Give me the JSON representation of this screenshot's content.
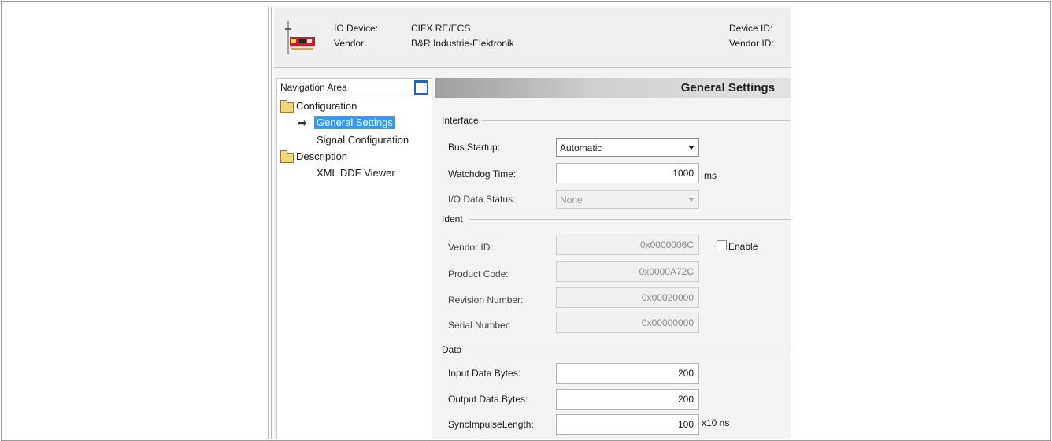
{
  "header": {
    "io_device_label": "IO Device:",
    "io_device_value": "CIFX RE/ECS",
    "vendor_label": "Vendor:",
    "vendor_value": "B&R Industrie-Elektronik",
    "device_id_label": "Device ID:",
    "vendor_id_label": "Vendor ID:"
  },
  "nav": {
    "title": "Navigation Area",
    "tree": [
      {
        "label": "Configuration",
        "icon": "folder-icon"
      },
      {
        "label": "General Settings",
        "selected": true,
        "icon": "arrow-right-icon"
      },
      {
        "label": "Signal Configuration"
      },
      {
        "label": "Description",
        "icon": "folder-icon"
      },
      {
        "label": "XML DDF Viewer"
      }
    ]
  },
  "page": {
    "title": "General Settings"
  },
  "interface": {
    "section": "Interface",
    "bus_startup_label": "Bus Startup:",
    "bus_startup_value": "Automatic",
    "watchdog_label": "Watchdog Time:",
    "watchdog_value": "1000",
    "watchdog_unit": "ms",
    "io_status_label": "I/O Data Status:",
    "io_status_value": "None"
  },
  "ident": {
    "section": "Ident",
    "vendor_id_label": "Vendor ID:",
    "vendor_id_value": "0x0000006C",
    "enable_label": "Enable",
    "product_code_label": "Product Code:",
    "product_code_value": "0x0000A72C",
    "revision_label": "Revision Number:",
    "revision_value": "0x00020000",
    "serial_label": "Serial Number:",
    "serial_value": "0x00000000"
  },
  "data": {
    "section": "Data",
    "input_label": "Input Data Bytes:",
    "input_value": "200",
    "output_label": "Output Data Bytes:",
    "output_value": "200",
    "sync_label": "SyncImpulseLength:",
    "sync_value": "100",
    "sync_unit": "x10 ns"
  },
  "colors": {
    "selection": "#3399ff",
    "accent": "#1a64c8",
    "banner_text": "#222222"
  }
}
